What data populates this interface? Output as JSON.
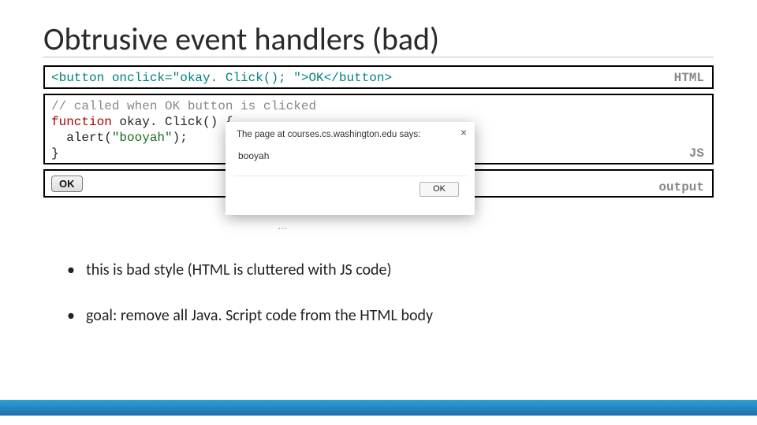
{
  "title": "Obtrusive event handlers (bad)",
  "html_box": {
    "line1": "<button onclick=\"okay. Click(); \">OK</button>",
    "tag": "HTML"
  },
  "js_box": {
    "line1": "// called when OK button is clicked",
    "line2_kw": "function",
    "line2_rest": " okay. Click() {",
    "line3_indent": "  alert(",
    "line3_str": "\"booyah\"",
    "line3_end": ");",
    "line4": "}",
    "tag": "JS"
  },
  "output_box": {
    "button_label": "OK",
    "tag": "output"
  },
  "dialog": {
    "title": "The page at courses.cs.washington.edu says:",
    "message": "booyah",
    "ok": "OK",
    "close": "×"
  },
  "dots": "…",
  "bullets": {
    "b1": "this is bad style (HTML is cluttered with JS code)",
    "b2": "goal: remove all Java. Script code from the HTML body"
  }
}
